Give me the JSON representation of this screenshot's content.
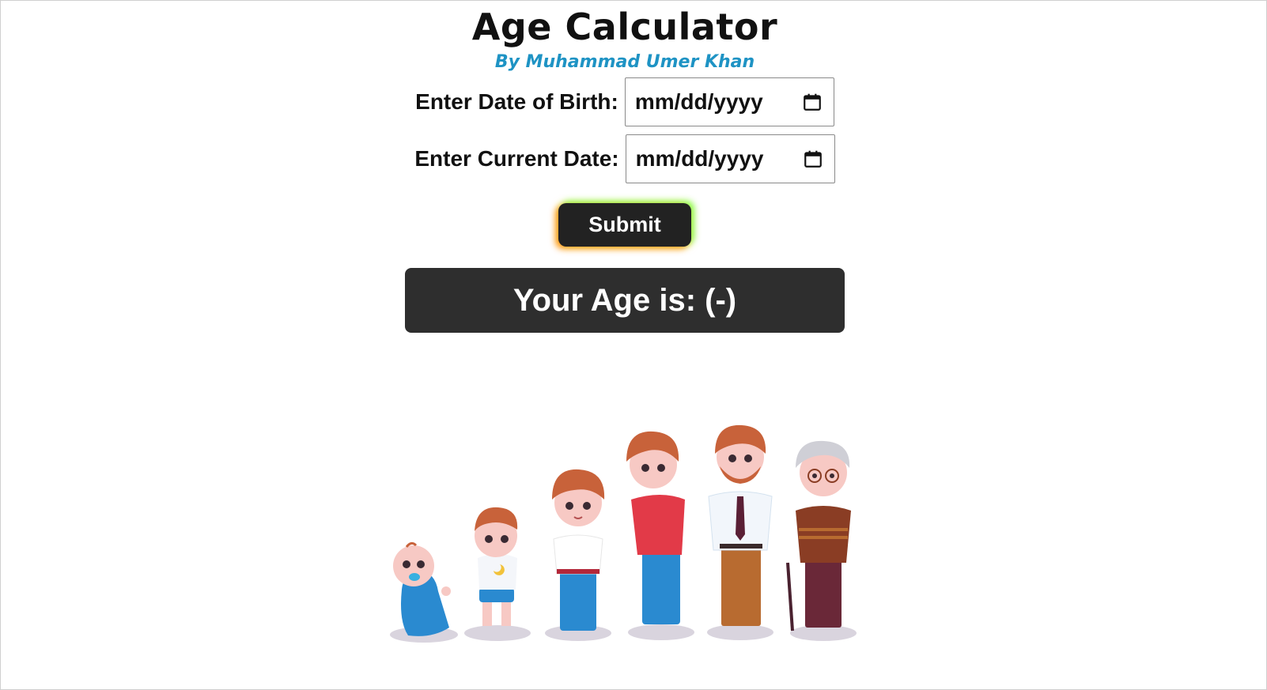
{
  "header": {
    "title": "Age Calculator",
    "subtitle": "By Muhammad Umer Khan"
  },
  "form": {
    "dob_label": "Enter Date of Birth:",
    "dob_placeholder": "mm/dd/yyyy",
    "current_label": "Enter Current Date:",
    "current_placeholder": "mm/dd/yyyy",
    "submit_label": "Submit"
  },
  "result": {
    "text": "Your Age is: (-)"
  },
  "icons": {
    "date_picker": "calendar-icon",
    "illustration": "age-stages-illustration"
  },
  "colors": {
    "subtitle": "#1e93c4",
    "button_bg": "#222222",
    "result_bg": "#2e2e2e"
  }
}
